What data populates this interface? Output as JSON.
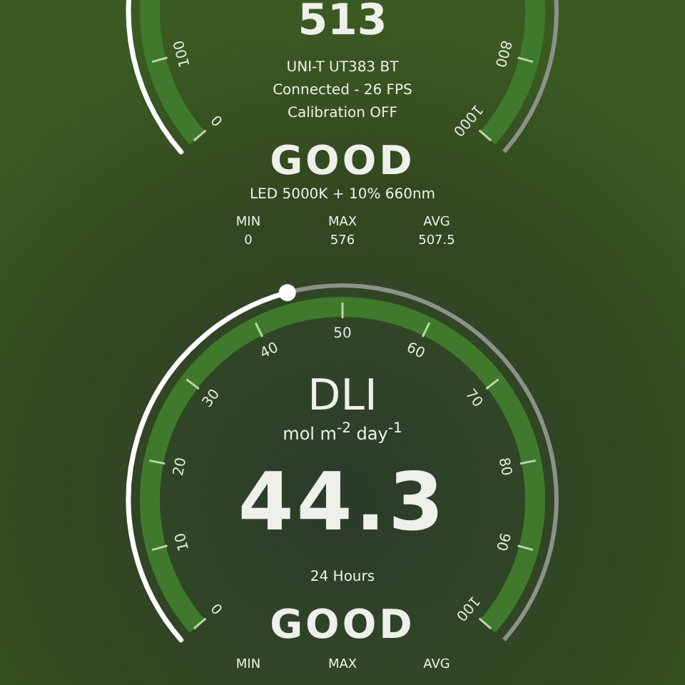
{
  "gauges": [
    {
      "value": "513",
      "info": [
        "UNI-T UT383 BT",
        "Connected - 26 FPS",
        "Calibration OFF"
      ],
      "status": "GOOD",
      "source": "LED 5000K + 10% 660nm",
      "scale_start": [
        "0",
        "100"
      ],
      "scale_end": [
        "800",
        "1000"
      ],
      "stats": [
        {
          "label": "MIN",
          "value": "0"
        },
        {
          "label": "MAX",
          "value": "576"
        },
        {
          "label": "AVG",
          "value": "507.5"
        }
      ]
    },
    {
      "title": "DLI",
      "unit": "mol m$^{-2}$ day$^{-1}$",
      "value": "44.3",
      "info": [
        "24 Hours"
      ],
      "status": "GOOD",
      "level": 0.443,
      "scale_start": [
        "0",
        "10",
        "20",
        "30",
        "40",
        "50",
        "60",
        "70",
        "80",
        "90",
        "100"
      ],
      "stats": [
        {
          "label": "MIN"
        },
        {
          "label": "MAX"
        },
        {
          "label": "AVG"
        }
      ]
    }
  ]
}
